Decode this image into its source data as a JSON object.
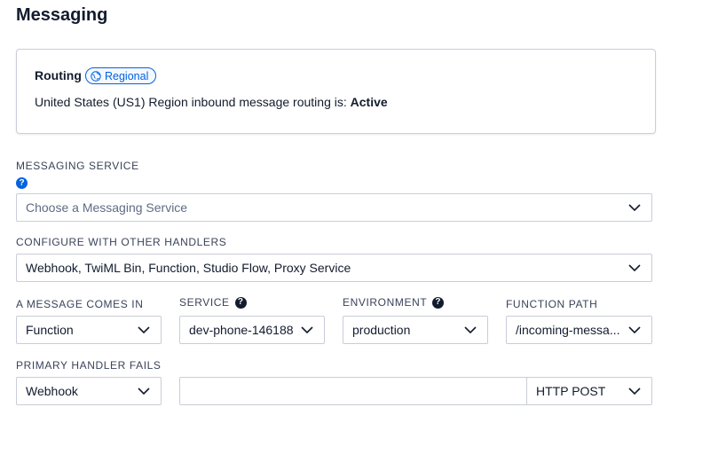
{
  "page": {
    "title": "Messaging"
  },
  "routing": {
    "title": "Routing",
    "badge": "Regional",
    "text_prefix": "United States (US1) Region inbound message routing is:",
    "status": "Active"
  },
  "messaging_service": {
    "label": "MESSAGING SERVICE",
    "placeholder": "Choose a Messaging Service"
  },
  "configure_handlers": {
    "label": "CONFIGURE WITH OTHER HANDLERS",
    "value": "Webhook, TwiML Bin, Function, Studio Flow, Proxy Service"
  },
  "message_comes_in": {
    "label": "A MESSAGE COMES IN",
    "value": "Function"
  },
  "service": {
    "label": "SERVICE",
    "value": "dev-phone-146188"
  },
  "environment": {
    "label": "ENVIRONMENT",
    "value": "production"
  },
  "function_path": {
    "label": "FUNCTION PATH",
    "value": "/incoming-messa..."
  },
  "primary_handler_fails": {
    "label": "PRIMARY HANDLER FAILS",
    "type_value": "Webhook",
    "url_value": "",
    "method_value": "HTTP POST"
  },
  "colors": {
    "accent": "#0263e0",
    "border": "#cacdd8",
    "text": "#121c2d"
  }
}
